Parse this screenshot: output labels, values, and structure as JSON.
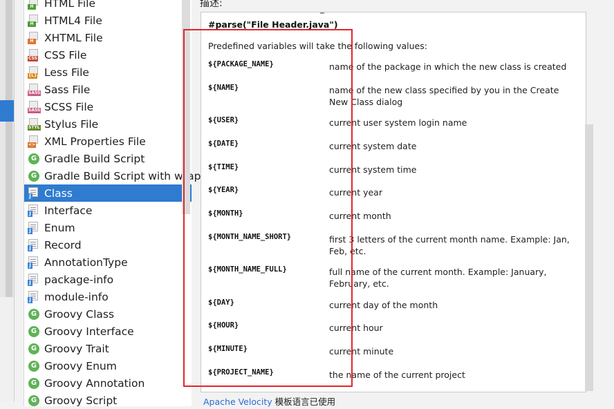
{
  "file_templates": [
    {
      "label": "HTML File",
      "icon": "html-file-icon",
      "kind": "file",
      "badge": "H",
      "color": "#4f9e3a",
      "selected": false
    },
    {
      "label": "HTML4 File",
      "icon": "html4-file-icon",
      "kind": "file",
      "badge": "H",
      "color": "#4f9e3a",
      "selected": false
    },
    {
      "label": "XHTML File",
      "icon": "xhtml-file-icon",
      "kind": "file",
      "badge": "H",
      "color": "#e0742f",
      "selected": false
    },
    {
      "label": "CSS File",
      "icon": "css-file-icon",
      "kind": "file",
      "badge": "CSS",
      "color": "#c44a3b",
      "selected": false
    },
    {
      "label": "Less File",
      "icon": "less-file-icon",
      "kind": "file",
      "badge": "{L}",
      "color": "#d98a1a",
      "selected": false
    },
    {
      "label": "Sass File",
      "icon": "sass-file-icon",
      "kind": "file",
      "badge": "SASS",
      "color": "#c75a86",
      "selected": false
    },
    {
      "label": "SCSS File",
      "icon": "scss-file-icon",
      "kind": "file",
      "badge": "SASS",
      "color": "#c75a86",
      "selected": false
    },
    {
      "label": "Stylus File",
      "icon": "stylus-file-icon",
      "kind": "file",
      "badge": "STYL",
      "color": "#6a8a2a",
      "selected": false
    },
    {
      "label": "XML Properties File",
      "icon": "xml-properties-file-icon",
      "kind": "file",
      "badge": "<>",
      "color": "#e0742f",
      "selected": false
    },
    {
      "label": "Gradle Build Script",
      "icon": "gradle-icon",
      "kind": "groovy",
      "badge": "G",
      "color": "#5fb356",
      "selected": false
    },
    {
      "label": "Gradle Build Script with wrap",
      "icon": "gradle-icon",
      "kind": "groovy",
      "badge": "G",
      "color": "#5fb356",
      "selected": false
    },
    {
      "label": "Class",
      "icon": "java-class-icon",
      "kind": "java",
      "badge": "J",
      "color": "#3a87d6",
      "selected": true
    },
    {
      "label": "Interface",
      "icon": "java-interface-icon",
      "kind": "java",
      "badge": "J",
      "color": "#3a87d6",
      "selected": false
    },
    {
      "label": "Enum",
      "icon": "java-enum-icon",
      "kind": "java",
      "badge": "J",
      "color": "#3a87d6",
      "selected": false
    },
    {
      "label": "Record",
      "icon": "java-record-icon",
      "kind": "java",
      "badge": "J",
      "color": "#3a87d6",
      "selected": false
    },
    {
      "label": "AnnotationType",
      "icon": "java-annotation-icon",
      "kind": "java",
      "badge": "J",
      "color": "#3a87d6",
      "selected": false
    },
    {
      "label": "package-info",
      "icon": "java-package-info-icon",
      "kind": "java",
      "badge": "J",
      "color": "#3a87d6",
      "selected": false
    },
    {
      "label": "module-info",
      "icon": "java-module-info-icon",
      "kind": "java",
      "badge": "J",
      "color": "#3a87d6",
      "selected": false
    },
    {
      "label": "Groovy Class",
      "icon": "groovy-icon",
      "kind": "groovy",
      "badge": "G",
      "color": "#5fb356",
      "selected": false
    },
    {
      "label": "Groovy Interface",
      "icon": "groovy-icon",
      "kind": "groovy",
      "badge": "G",
      "color": "#5fb356",
      "selected": false
    },
    {
      "label": "Groovy Trait",
      "icon": "groovy-icon",
      "kind": "groovy",
      "badge": "G",
      "color": "#5fb356",
      "selected": false
    },
    {
      "label": "Groovy Enum",
      "icon": "groovy-icon",
      "kind": "groovy",
      "badge": "G",
      "color": "#5fb356",
      "selected": false
    },
    {
      "label": "Groovy Annotation",
      "icon": "groovy-icon",
      "kind": "groovy",
      "badge": "G",
      "color": "#5fb356",
      "selected": false
    },
    {
      "label": "Groovy Script",
      "icon": "groovy-icon",
      "kind": "groovy",
      "badge": "G",
      "color": "#5fb356",
      "selected": false
    }
  ],
  "description": {
    "label": "描述:",
    "parse_line": "#parse(\"File Header.java\")",
    "intro": "Predefined variables will take the following values:",
    "variables": [
      {
        "name": "${PACKAGE_NAME}",
        "desc": "name of the package in which the new class is created"
      },
      {
        "name": "${NAME}",
        "desc": "name of the new class specified by you in the Create New Class dialog"
      },
      {
        "name": "${USER}",
        "desc": "current user system login name"
      },
      {
        "name": "${DATE}",
        "desc": "current system date"
      },
      {
        "name": "${TIME}",
        "desc": "current system time"
      },
      {
        "name": "${YEAR}",
        "desc": "current year"
      },
      {
        "name": "${MONTH}",
        "desc": "current month"
      },
      {
        "name": "${MONTH_NAME_SHORT}",
        "desc": "first 3 letters of the current month name. Example: Jan, Feb, etc."
      },
      {
        "name": "${MONTH_NAME_FULL}",
        "desc": "full name of the current month. Example: January, February, etc."
      },
      {
        "name": "${DAY}",
        "desc": "current day of the month"
      },
      {
        "name": "${HOUR}",
        "desc": "current hour"
      },
      {
        "name": "${MINUTE}",
        "desc": "current minute"
      },
      {
        "name": "${PROJECT_NAME}",
        "desc": "the name of the current project"
      }
    ]
  },
  "footer": {
    "link": "Apache Velocity",
    "text": " 模板语言已使用"
  },
  "colors": {
    "selection": "#2f7bd0",
    "highlight_box": "#e0262c",
    "link": "#2f6bd6"
  }
}
